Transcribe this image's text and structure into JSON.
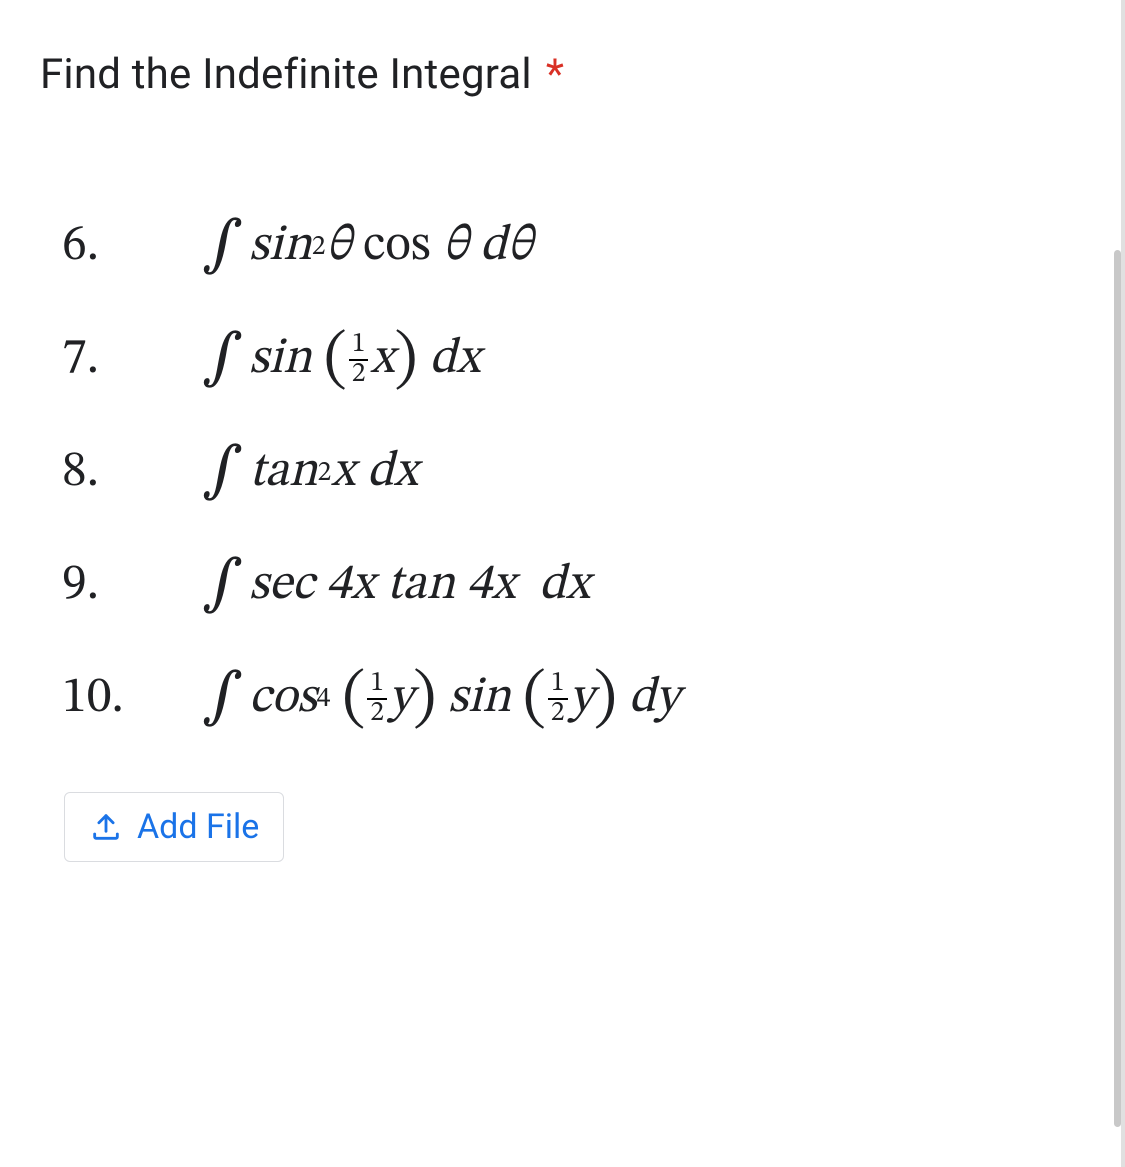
{
  "question": {
    "title": "Find the Indefinite Integral",
    "required_marker": "*"
  },
  "problems": [
    {
      "number": "6.",
      "latex": "\\int \\sin^{2}\\theta \\cos\\theta\\, d\\theta"
    },
    {
      "number": "7.",
      "latex": "\\int \\sin\\left(\\tfrac{1}{2}x\\right) dx"
    },
    {
      "number": "8.",
      "latex": "\\int \\tan^{2}x\\, dx"
    },
    {
      "number": "9.",
      "latex": "\\int \\sec 4x \\tan 4x\\; dx"
    },
    {
      "number": "10.",
      "latex": "\\int \\cos^{4}\\left(\\tfrac{1}{2}y\\right)\\sin\\left(\\tfrac{1}{2}y\\right) dy"
    }
  ],
  "add_file": {
    "label": "Add File",
    "icon": "upload-icon"
  },
  "colors": {
    "required": "#d93025",
    "link": "#1a73e8",
    "border": "#dadce0"
  }
}
